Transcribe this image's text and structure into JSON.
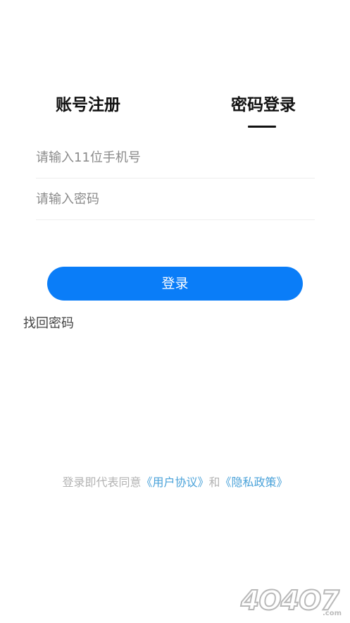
{
  "tabs": {
    "register_label": "账号注册",
    "password_login_label": "密码登录"
  },
  "form": {
    "phone_placeholder": "请输入11位手机号",
    "password_placeholder": "请输入密码",
    "login_button_label": "登录"
  },
  "forgot_password_label": "找回密码",
  "agreement": {
    "prefix": "登录即代表同意",
    "user_agreement_link": "《用户协议》",
    "conjunction": "和",
    "privacy_policy_link": "《隐私政策》"
  },
  "watermark": {
    "text": "4O4O7",
    "suffix": ".com"
  },
  "colors": {
    "primary": "#0a7df8",
    "link": "#4aa2d9"
  }
}
